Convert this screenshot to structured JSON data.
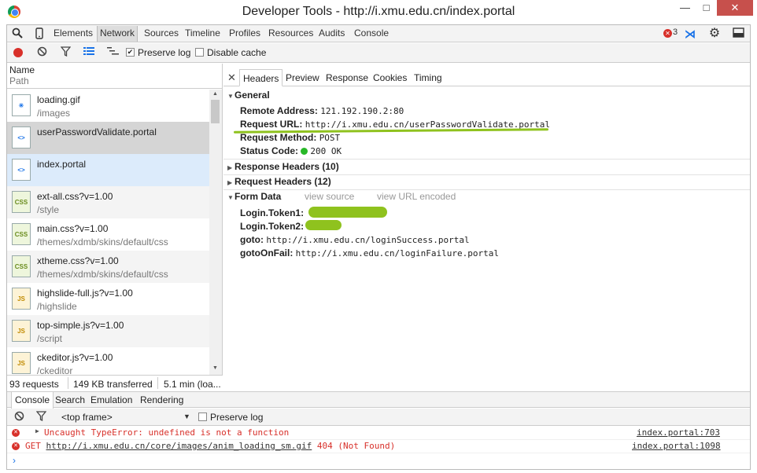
{
  "window": {
    "title": "Developer Tools - http://i.xmu.edu.cn/index.portal",
    "min": "—",
    "max": "□",
    "close": "✕"
  },
  "main_tabs": [
    "Elements",
    "Network",
    "Sources",
    "Timeline",
    "Profiles",
    "Resources",
    "Audits",
    "Console"
  ],
  "active_main_tab": "Network",
  "error_count": "3",
  "network_toolbar": {
    "preserve_log": "Preserve log",
    "disable_cache": "Disable cache",
    "preserve_log_checked": true,
    "disable_cache_checked": false
  },
  "columns": {
    "name": "Name",
    "path": "Path"
  },
  "requests": [
    {
      "name": "loading.gif",
      "path": "/images",
      "type": "img"
    },
    {
      "name": "userPasswordValidate.portal",
      "path": "",
      "type": "doc"
    },
    {
      "name": "index.portal",
      "path": "",
      "type": "doc"
    },
    {
      "name": "ext-all.css?v=1.00",
      "path": "/style",
      "type": "css"
    },
    {
      "name": "main.css?v=1.00",
      "path": "/themes/xdmb/skins/default/css",
      "type": "css"
    },
    {
      "name": "xtheme.css?v=1.00",
      "path": "/themes/xdmb/skins/default/css",
      "type": "css"
    },
    {
      "name": "highslide-full.js?v=1.00",
      "path": "/highslide",
      "type": "js"
    },
    {
      "name": "top-simple.js?v=1.00",
      "path": "/script",
      "type": "js"
    },
    {
      "name": "ckeditor.js?v=1.00",
      "path": "/ckeditor",
      "type": "js"
    }
  ],
  "icon_labels": {
    "css": "CSS",
    "js": "JS",
    "doc": "<>",
    "img": "✳"
  },
  "status_bar": {
    "requests": "93 requests",
    "transferred": "149 KB transferred",
    "time": "5.1 min (loa..."
  },
  "detail_tabs": [
    "Headers",
    "Preview",
    "Response",
    "Cookies",
    "Timing"
  ],
  "active_detail_tab": "Headers",
  "general": {
    "title": "General",
    "remote_address_key": "Remote Address:",
    "remote_address": "121.192.190.2:80",
    "request_url_key": "Request URL:",
    "request_url": "http://i.xmu.edu.cn/userPasswordValidate.portal",
    "request_method_key": "Request Method:",
    "request_method": "POST",
    "status_code_key": "Status Code:",
    "status_code": "200 OK"
  },
  "response_headers": "Response Headers (10)",
  "request_headers": "Request Headers (12)",
  "form_data": {
    "title": "Form Data",
    "view_source": "view source",
    "view_url_encoded": "view URL encoded",
    "token1_key": "Login.Token1:",
    "token2_key": "Login.Token2:",
    "goto_key": "goto:",
    "goto": "http://i.xmu.edu.cn/loginSuccess.portal",
    "goto_fail_key": "gotoOnFail:",
    "goto_fail": "http://i.xmu.edu.cn/loginFailure.portal"
  },
  "console_tabs": [
    "Console",
    "Search",
    "Emulation",
    "Rendering"
  ],
  "active_console_tab": "Console",
  "console_toolbar": {
    "frame": "<top frame>",
    "preserve_log": "Preserve log"
  },
  "console_messages": [
    {
      "text": "Uncaught TypeError: undefined is not a function",
      "source": "index.portal:703",
      "expandable": true
    },
    {
      "text_prefix": "GET ",
      "url": "http://i.xmu.edu.cn/core/images/anim_loading_sm.gif",
      "text_suffix": " 404 (Not Found)",
      "source": "index.portal:1098",
      "expandable": false
    }
  ],
  "console_prompt": "›",
  "colors": {
    "accent_green": "#8fc21e",
    "error_red": "#d8302a",
    "selected_row": "#d5d5d5",
    "hover_row": "#dcebfb"
  }
}
